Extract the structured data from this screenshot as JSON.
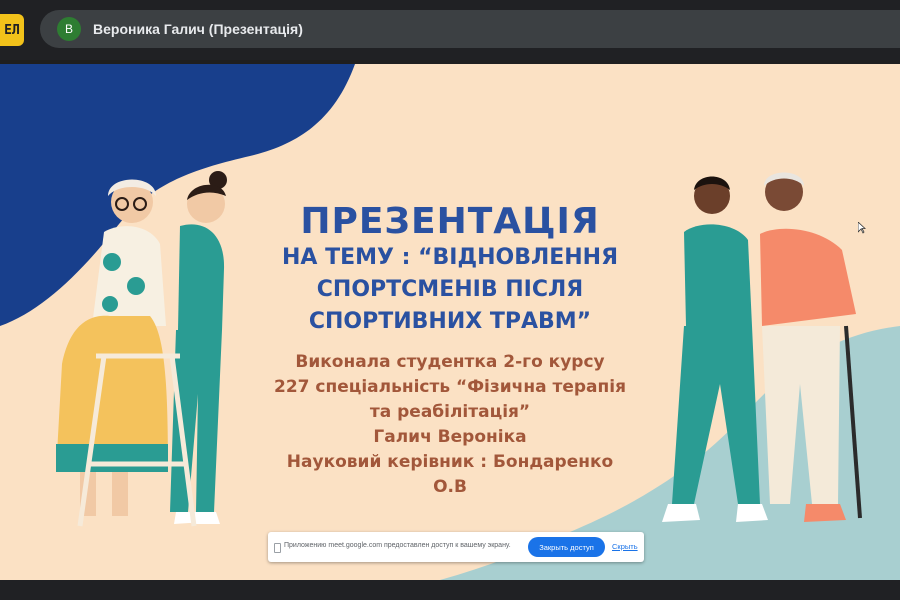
{
  "app": {
    "icon_glyph": "ЕЛ",
    "window_title": "Вероника Галич (Презентація)",
    "avatar_letter": "В",
    "avatar_color": "#2e7d32"
  },
  "slide": {
    "title": "ПРЕЗЕНТАЦІЯ",
    "topic_lines": [
      "НА ТЕМУ : “ВІДНОВЛЕННЯ",
      "СПОРТСМЕНІВ ПІСЛЯ",
      "СПОРТИВНИХ ТРАВМ”"
    ],
    "author_lines": [
      "Виконала студентка 2-го курсу",
      "227 спеціальність “Фізична терапія",
      "та реабілітація”",
      "Галич Вероніка",
      "Науковий керівник : Бондаренко",
      "О.В"
    ],
    "colors": {
      "background": "#fbe1c4",
      "blue_shape": "#183f8c",
      "teal_shape": "#a8cfd0",
      "title": "#2a51a1",
      "author_text": "#a2573a",
      "scrubs": "#2a9c93"
    }
  },
  "share_notice": {
    "text": "Приложению meet.google.com предоставлен доступ к вашему экрану.",
    "stop_button": "Закрыть доступ",
    "hide_link": "Скрыть"
  }
}
